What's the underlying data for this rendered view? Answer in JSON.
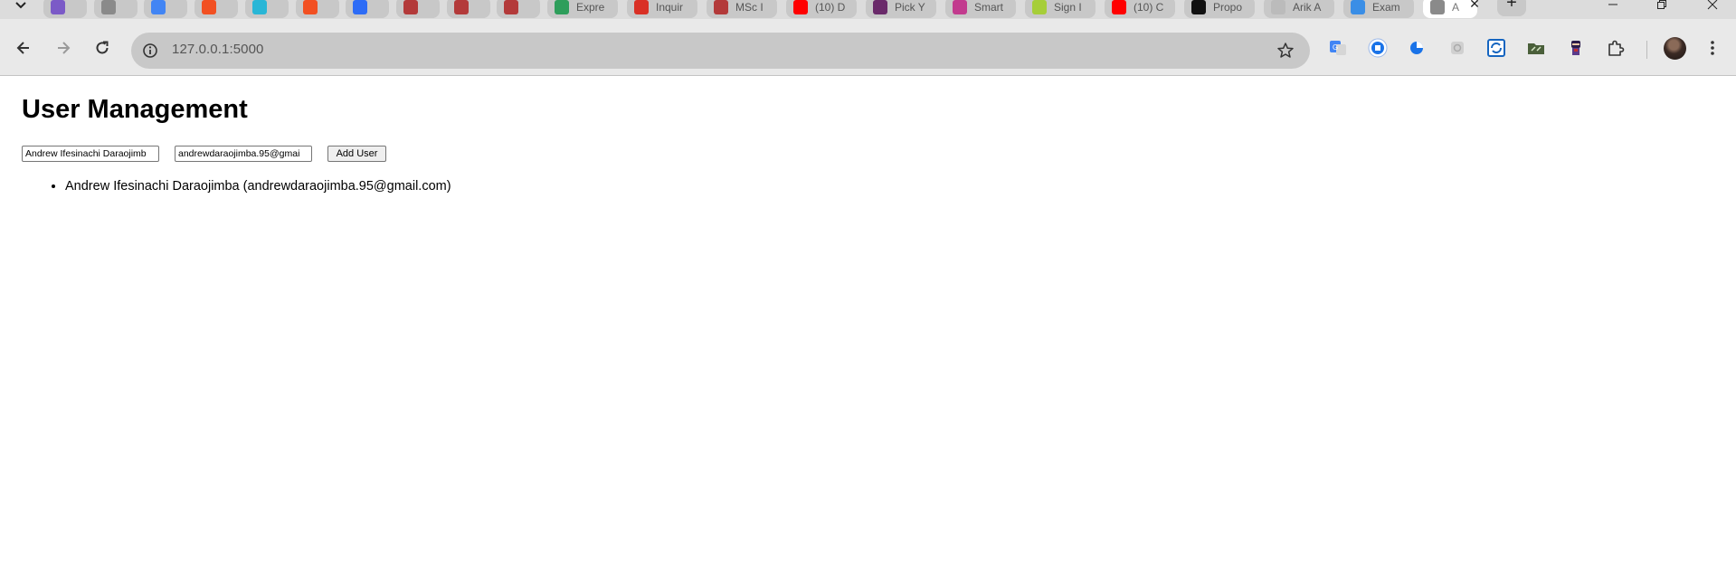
{
  "browser": {
    "tabs": [
      {
        "favicon": "chatgpt-icon",
        "title": "",
        "color": "#7b5ac7"
      },
      {
        "favicon": "globe-icon",
        "title": "",
        "color": "#8a8a8a"
      },
      {
        "favicon": "google-docs-icon",
        "title": "",
        "color": "#4285f4"
      },
      {
        "favicon": "microsoft-icon",
        "title": "",
        "color": "#f25022"
      },
      {
        "favicon": "file-icon",
        "title": "",
        "color": "#29b6d6"
      },
      {
        "favicon": "microsoft-icon",
        "title": "",
        "color": "#f25022"
      },
      {
        "favicon": "zoom-icon",
        "title": "",
        "color": "#2d6cf6"
      },
      {
        "favicon": "cube-icon",
        "title": "",
        "color": "#b33a3a"
      },
      {
        "favicon": "cube-icon",
        "title": "",
        "color": "#b33a3a"
      },
      {
        "favicon": "cube-icon",
        "title": "",
        "color": "#b33a3a"
      },
      {
        "favicon": "express-icon",
        "title": "Expre",
        "color": "#2e9e5b"
      },
      {
        "favicon": "gmail-icon",
        "title": "Inquir",
        "color": "#d93025"
      },
      {
        "favicon": "cube-icon",
        "title": "MSc I",
        "color": "#b33a3a"
      },
      {
        "favicon": "youtube-icon",
        "title": "(10) D",
        "color": "#ff0000"
      },
      {
        "favicon": "pick-icon",
        "title": "Pick Y",
        "color": "#6a2a6a"
      },
      {
        "favicon": "smart-icon",
        "title": "Smart",
        "color": "#c23b8e"
      },
      {
        "favicon": "id-icon",
        "title": "Sign I",
        "color": "#a6ce39"
      },
      {
        "favicon": "youtube-icon",
        "title": "(10) C",
        "color": "#ff0000"
      },
      {
        "favicon": "chatgpt-icon",
        "title": "Propo",
        "color": "#111111"
      },
      {
        "favicon": "pen-icon",
        "title": "Arik A",
        "color": "#bbbbbb"
      },
      {
        "favicon": "exam-icon",
        "title": "Exam",
        "color": "#3a8ee6"
      },
      {
        "favicon": "globe-icon",
        "title": "A",
        "color": "#8a8a8a",
        "active": true
      }
    ],
    "new_tab_label": "+",
    "close_tab_label": "✕",
    "url": "127.0.0.1:5000"
  },
  "page": {
    "title": "User Management",
    "name_input": {
      "value": "Andrew Ifesinachi Daraojimb",
      "placeholder": ""
    },
    "email_input": {
      "value": "andrewdaraojimba.95@gmai",
      "placeholder": ""
    },
    "add_button": "Add User",
    "users": [
      "Andrew Ifesinachi Daraojimba (andrewdaraojimba.95@gmail.com)"
    ]
  }
}
